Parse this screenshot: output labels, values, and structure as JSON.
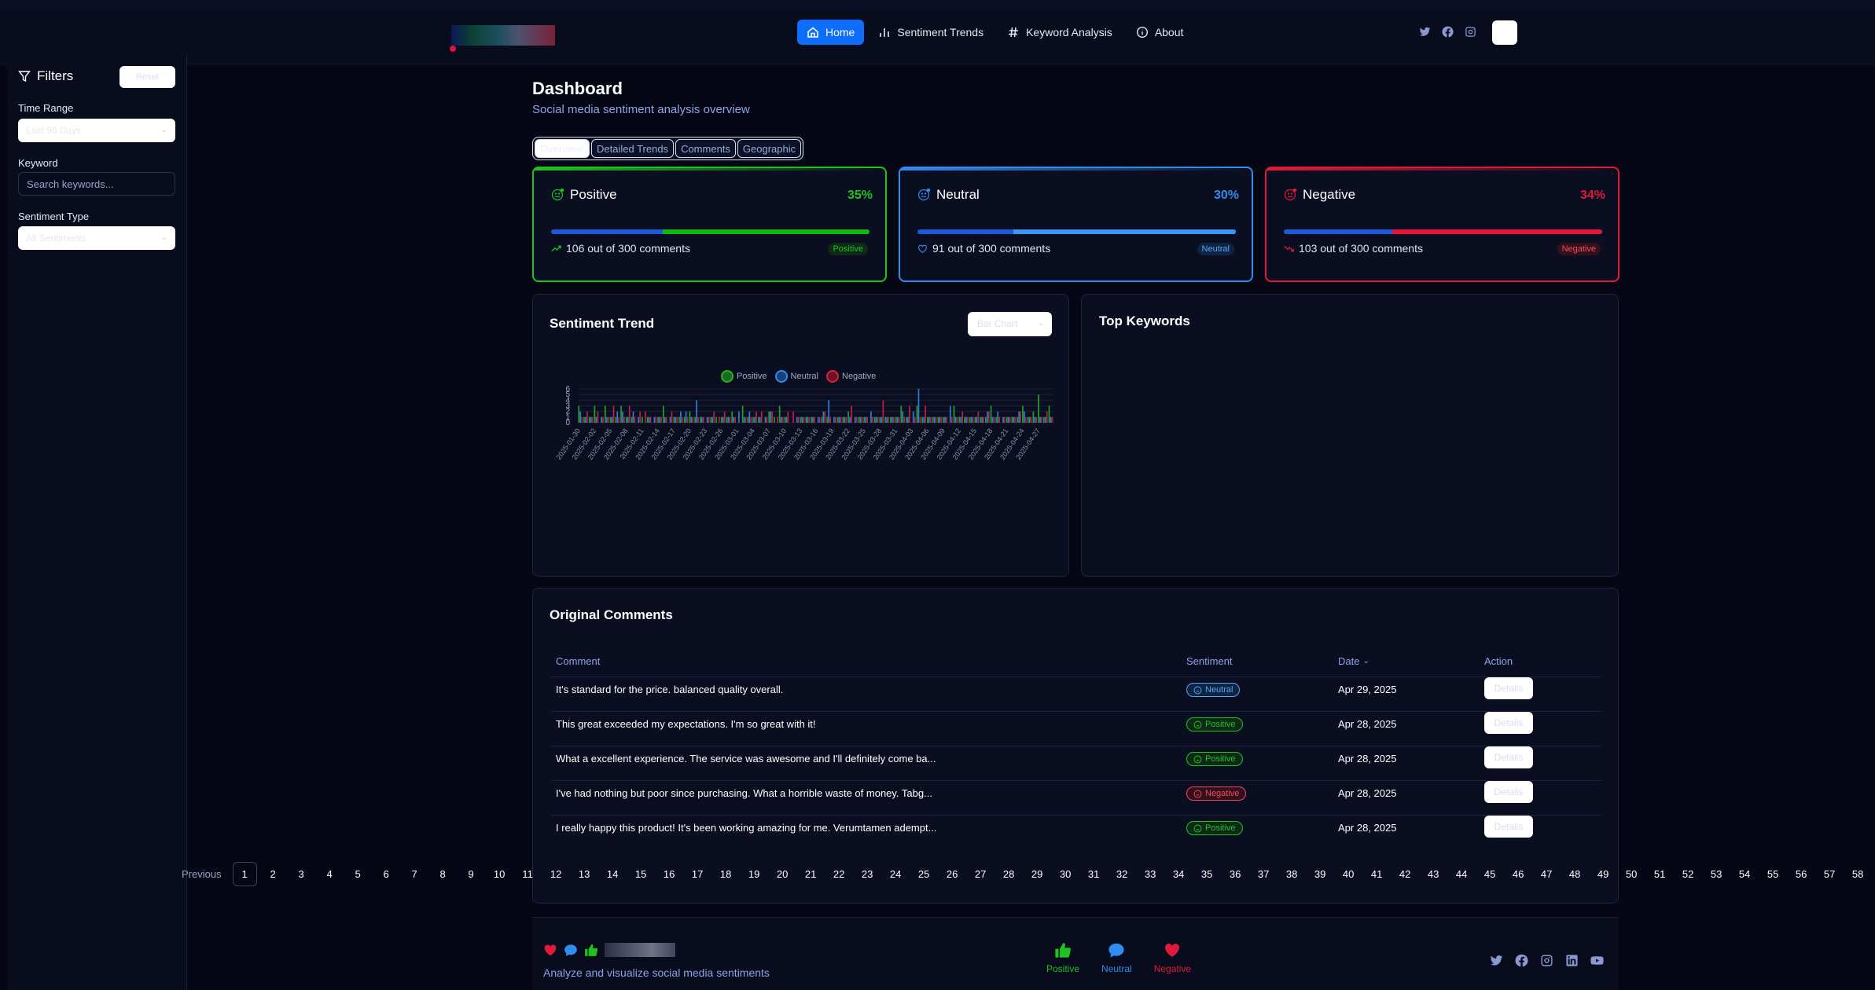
{
  "nav": {
    "links": [
      {
        "label": "Home",
        "icon": "home-icon",
        "active": true
      },
      {
        "label": "Sentiment Trends",
        "icon": "bar-chart-icon",
        "active": false
      },
      {
        "label": "Keyword Analysis",
        "icon": "hash-icon",
        "active": false
      },
      {
        "label": "About",
        "icon": "info-icon",
        "active": false
      }
    ]
  },
  "sidebar": {
    "title": "Filters",
    "reset_label": "Reset",
    "time_range_label": "Time Range",
    "time_range_value": "Last 90 Days",
    "keyword_label": "Keyword",
    "keyword_placeholder": "Search keywords...",
    "sentiment_type_label": "Sentiment Type",
    "sentiment_type_value": "All Sentiments"
  },
  "header": {
    "title": "Dashboard",
    "subtitle": "Social media sentiment analysis overview"
  },
  "tabs": [
    "Overview",
    "Detailed Trends",
    "Comments",
    "Geographic"
  ],
  "cards": {
    "positive": {
      "label": "Positive",
      "percent": "35%",
      "count_text": "106 out of 300 comments",
      "badge": "Positive",
      "color": "#1fc31f"
    },
    "neutral": {
      "label": "Neutral",
      "percent": "30%",
      "count_text": "91 out of 300 comments",
      "badge": "Neutral",
      "color": "#2f8cf0"
    },
    "negative": {
      "label": "Negative",
      "percent": "34%",
      "count_text": "103 out of 300 comments",
      "badge": "Negative",
      "color": "#e01a3a"
    }
  },
  "trend": {
    "title": "Sentiment Trend",
    "chart_type_value": "Bar Chart"
  },
  "keywords": {
    "title": "Top Keywords"
  },
  "chart_data": {
    "type": "bar",
    "title": "",
    "xlabel": "",
    "ylabel": "",
    "ylim": [
      0,
      6
    ],
    "yticks": [
      0,
      1,
      2,
      3,
      4,
      5,
      6
    ],
    "legend_position": "top-center",
    "grid": true,
    "categories": [
      "2025-01-30",
      "2025-01-31",
      "2025-02-01",
      "2025-02-02",
      "2025-02-03",
      "2025-02-04",
      "2025-02-05",
      "2025-02-06",
      "2025-02-07",
      "2025-02-08",
      "2025-02-09",
      "2025-02-10",
      "2025-02-11",
      "2025-02-12",
      "2025-02-13",
      "2025-02-14",
      "2025-02-15",
      "2025-02-16",
      "2025-02-17",
      "2025-02-18",
      "2025-02-19",
      "2025-02-20",
      "2025-02-21",
      "2025-02-22",
      "2025-02-23",
      "2025-02-24",
      "2025-02-25",
      "2025-02-26",
      "2025-02-27",
      "2025-02-28",
      "2025-03-01",
      "2025-03-02",
      "2025-03-03",
      "2025-03-04",
      "2025-03-05",
      "2025-03-06",
      "2025-03-07",
      "2025-03-08",
      "2025-03-09",
      "2025-03-10",
      "2025-03-11",
      "2025-03-12",
      "2025-03-13",
      "2025-03-14",
      "2025-03-15",
      "2025-03-16",
      "2025-03-17",
      "2025-03-18",
      "2025-03-19",
      "2025-03-20",
      "2025-03-21",
      "2025-03-22",
      "2025-03-23",
      "2025-03-24",
      "2025-03-25",
      "2025-03-26",
      "2025-03-27",
      "2025-03-28",
      "2025-03-29",
      "2025-03-30",
      "2025-03-31",
      "2025-04-01",
      "2025-04-02",
      "2025-04-03",
      "2025-04-04",
      "2025-04-05",
      "2025-04-06",
      "2025-04-07",
      "2025-04-08",
      "2025-04-09",
      "2025-04-10",
      "2025-04-11",
      "2025-04-12",
      "2025-04-13",
      "2025-04-14",
      "2025-04-15",
      "2025-04-16",
      "2025-04-17",
      "2025-04-18",
      "2025-04-19",
      "2025-04-20",
      "2025-04-21",
      "2025-04-22",
      "2025-04-23",
      "2025-04-24",
      "2025-04-25",
      "2025-04-26",
      "2025-04-27",
      "2025-04-28",
      "2025-04-29"
    ],
    "tick_labels": [
      "2025-01-30",
      "2025-02-02",
      "2025-02-05",
      "2025-02-08",
      "2025-02-11",
      "2025-02-14",
      "2025-02-17",
      "2025-02-20",
      "2025-02-23",
      "2025-02-26",
      "2025-03-01",
      "2025-03-04",
      "2025-03-07",
      "2025-03-10",
      "2025-03-13",
      "2025-03-16",
      "2025-03-19",
      "2025-03-22",
      "2025-03-25",
      "2025-03-28",
      "2025-03-31",
      "2025-04-03",
      "2025-04-06",
      "2025-04-09",
      "2025-04-12",
      "2025-04-15",
      "2025-04-18",
      "2025-04-21",
      "2025-04-24",
      "2025-04-27"
    ],
    "series": [
      {
        "name": "Positive",
        "color": "#22b422",
        "values": [
          3,
          1,
          1,
          3,
          0,
          3,
          1,
          1,
          3,
          1,
          1,
          0,
          1,
          1,
          0,
          1,
          3,
          0,
          1,
          1,
          1,
          2,
          1,
          1,
          0,
          1,
          1,
          1,
          1,
          2,
          0,
          3,
          1,
          1,
          1,
          0,
          2,
          1,
          3,
          1,
          0,
          0,
          1,
          1,
          1,
          0,
          1,
          1,
          0,
          1,
          1,
          2,
          0,
          1,
          1,
          0,
          1,
          1,
          1,
          1,
          1,
          3,
          1,
          0,
          3,
          1,
          1,
          1,
          1,
          1,
          0,
          3,
          1,
          1,
          1,
          1,
          1,
          1,
          3,
          1,
          0,
          1,
          1,
          1,
          3,
          1,
          2,
          5,
          1,
          3
        ]
      },
      {
        "name": "Neutral",
        "color": "#2f8cf0",
        "values": [
          2,
          1,
          1,
          1,
          1,
          1,
          1,
          2,
          2,
          1,
          2,
          1,
          0,
          1,
          1,
          1,
          1,
          1,
          1,
          2,
          2,
          1,
          4,
          1,
          1,
          1,
          0,
          1,
          1,
          1,
          2,
          1,
          2,
          1,
          1,
          1,
          2,
          0,
          1,
          1,
          0,
          1,
          1,
          1,
          1,
          1,
          2,
          4,
          1,
          1,
          1,
          1,
          1,
          1,
          1,
          2,
          1,
          1,
          1,
          1,
          1,
          2,
          1,
          2,
          6,
          1,
          1,
          1,
          1,
          1,
          3,
          1,
          1,
          1,
          1,
          1,
          1,
          2,
          1,
          2,
          1,
          1,
          1,
          2,
          2,
          1,
          1,
          1,
          1,
          1
        ]
      },
      {
        "name": "Negative",
        "color": "#d8223f",
        "values": [
          1,
          2,
          1,
          2,
          1,
          1,
          3,
          1,
          1,
          3,
          1,
          2,
          2,
          1,
          1,
          1,
          1,
          2,
          1,
          1,
          1,
          1,
          1,
          1,
          1,
          2,
          1,
          2,
          1,
          1,
          0,
          1,
          1,
          2,
          2,
          1,
          2,
          1,
          1,
          2,
          2,
          1,
          1,
          1,
          1,
          1,
          2,
          1,
          1,
          1,
          1,
          3,
          1,
          1,
          1,
          1,
          1,
          4,
          1,
          1,
          1,
          1,
          3,
          1,
          1,
          3,
          1,
          1,
          1,
          1,
          1,
          1,
          2,
          1,
          1,
          2,
          1,
          2,
          1,
          1,
          1,
          1,
          1,
          2,
          1,
          1,
          1,
          1,
          2,
          1
        ]
      }
    ]
  },
  "comments": {
    "title": "Original Comments",
    "columns": [
      "Comment",
      "Sentiment",
      "Date",
      "Action"
    ],
    "details_label": "Details",
    "rows": [
      {
        "text": "It's standard for the price. balanced quality overall.",
        "sentiment": "Neutral",
        "date": "Apr 29, 2025"
      },
      {
        "text": "This great exceeded my expectations. I'm so great with it!",
        "sentiment": "Positive",
        "date": "Apr 28, 2025"
      },
      {
        "text": "What a excellent experience. The service was awesome and I'll definitely come ba...",
        "sentiment": "Positive",
        "date": "Apr 28, 2025"
      },
      {
        "text": "I've had nothing but poor since purchasing. What a horrible waste of money. Tabg...",
        "sentiment": "Negative",
        "date": "Apr 28, 2025"
      },
      {
        "text": "I really happy this product! It's been working amazing for me. Verumtamen adempt...",
        "sentiment": "Positive",
        "date": "Apr 28, 2025"
      }
    ]
  },
  "pagination": {
    "previous": "Previous",
    "current": 1,
    "pages": [
      "1",
      "2",
      "3",
      "4",
      "5",
      "6",
      "7",
      "8",
      "9",
      "10",
      "11",
      "12",
      "13",
      "14",
      "15",
      "16",
      "17",
      "18",
      "19",
      "20",
      "21",
      "22",
      "23",
      "24",
      "25",
      "26",
      "27",
      "28",
      "29",
      "30",
      "31",
      "32",
      "33",
      "34",
      "35",
      "36",
      "37",
      "38",
      "39",
      "40",
      "41",
      "42",
      "43",
      "44",
      "45",
      "46",
      "47",
      "48",
      "49",
      "50",
      "51",
      "52",
      "53",
      "54",
      "55",
      "56",
      "57",
      "58"
    ]
  },
  "footer": {
    "tagline": "Analyze and visualize social media sentiments",
    "legend": [
      {
        "label": "Positive",
        "color": "#1fc31f",
        "icon": "thumbs-up-icon"
      },
      {
        "label": "Neutral",
        "color": "#2f8cf0",
        "icon": "chat-icon"
      },
      {
        "label": "Negative",
        "color": "#e01a3a",
        "icon": "heart-icon"
      }
    ]
  }
}
